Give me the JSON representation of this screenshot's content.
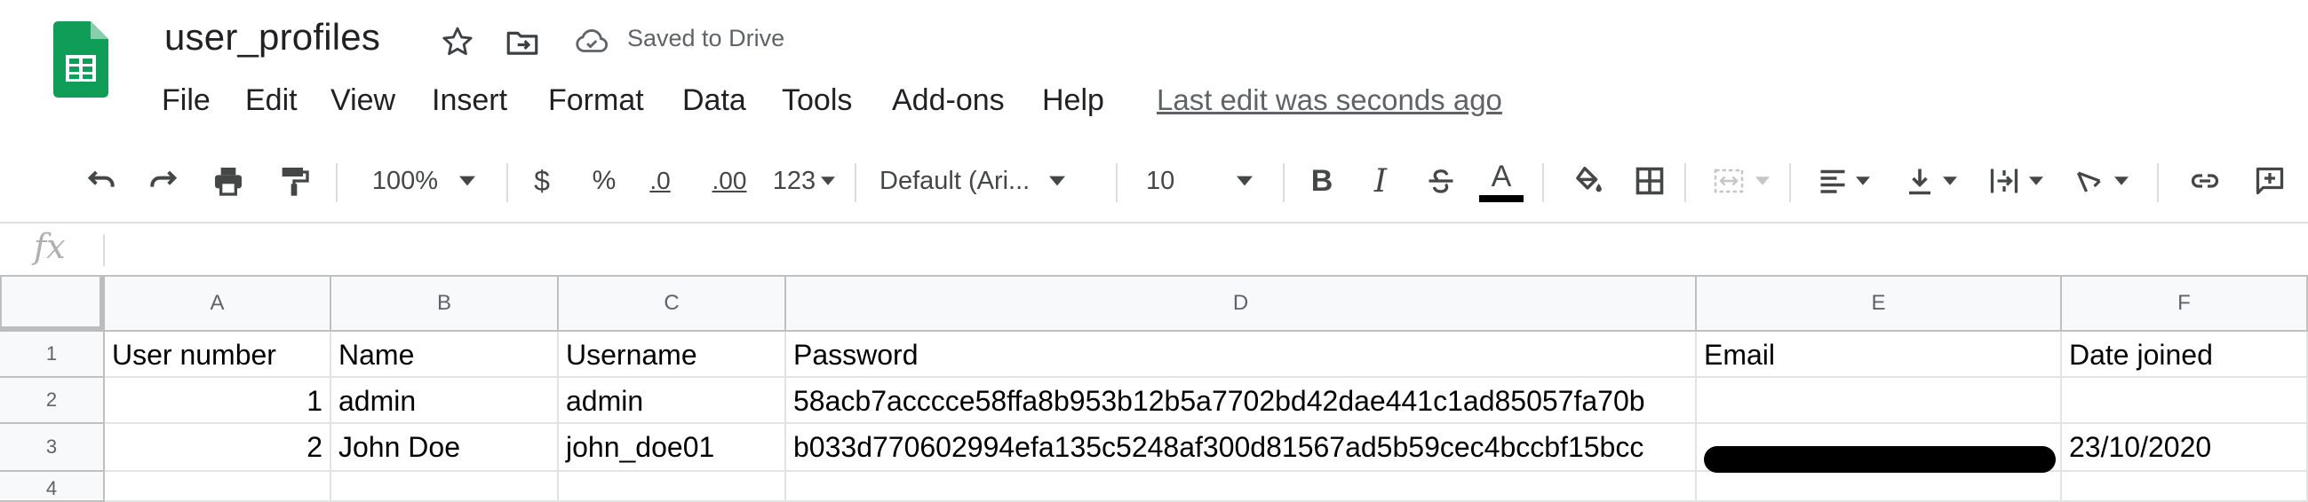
{
  "document": {
    "title": "user_profiles",
    "save_status": "Saved to Drive",
    "last_edit": "Last edit was seconds ago"
  },
  "menu": [
    "File",
    "Edit",
    "View",
    "Insert",
    "Format",
    "Data",
    "Tools",
    "Add-ons",
    "Help"
  ],
  "toolbar": {
    "zoom": "100%",
    "currency": "$",
    "percent": "%",
    "decrease_decimal": ".0",
    "increase_decimal": ".00",
    "number_format": "123",
    "font_family": "Default (Ari...",
    "font_size": "10",
    "bold": "B",
    "italic": "I",
    "text_color": "A"
  },
  "formula_bar": {
    "fx_label": "fx",
    "content": ""
  },
  "sheet": {
    "columns": [
      "A",
      "B",
      "C",
      "D",
      "E",
      "F"
    ],
    "rows": [
      "1",
      "2",
      "3",
      "4"
    ],
    "cells": [
      [
        "User number",
        "Name",
        "Username",
        "Password",
        "Email",
        "Date joined"
      ],
      [
        "1",
        "admin",
        "admin",
        "58acb7acccce58ffa8b953b12b5a7702bd42dae441c1ad85057fa70b",
        "",
        ""
      ],
      [
        "2",
        "John Doe",
        "john_doe01",
        "b033d770602994efa135c5248af300d81567ad5b59cec4bccbf15bcc",
        "",
        "23/10/2020"
      ],
      [
        "",
        "",
        "",
        "",
        "",
        ""
      ]
    ]
  },
  "colors": {
    "sheets_green": "#0f9d58",
    "sheets_green_dark": "#188038",
    "grid_line": "#e2e3e3",
    "header_bg": "#f8f9fa"
  }
}
